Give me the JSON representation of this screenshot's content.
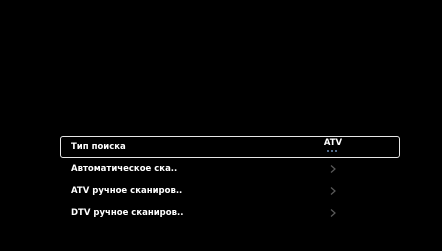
{
  "menu": {
    "items": [
      {
        "label": "Тип поиска",
        "value": "ATV",
        "selected": true,
        "indicator": "dots"
      },
      {
        "label": "Автоматическое ска..",
        "selected": false,
        "indicator": "chevron-right-icon"
      },
      {
        "label": "ATV ручное сканиров..",
        "selected": false,
        "indicator": "chevron-right-icon"
      },
      {
        "label": "DTV ручное сканиров..",
        "selected": false,
        "indicator": "chevron-right-icon"
      }
    ]
  },
  "colors": {
    "background": "#000000",
    "text": "#ffffff",
    "highlight_border": "#e6e6e6",
    "chevron": "#5a5a5a",
    "dots": "#6f8fb8"
  }
}
